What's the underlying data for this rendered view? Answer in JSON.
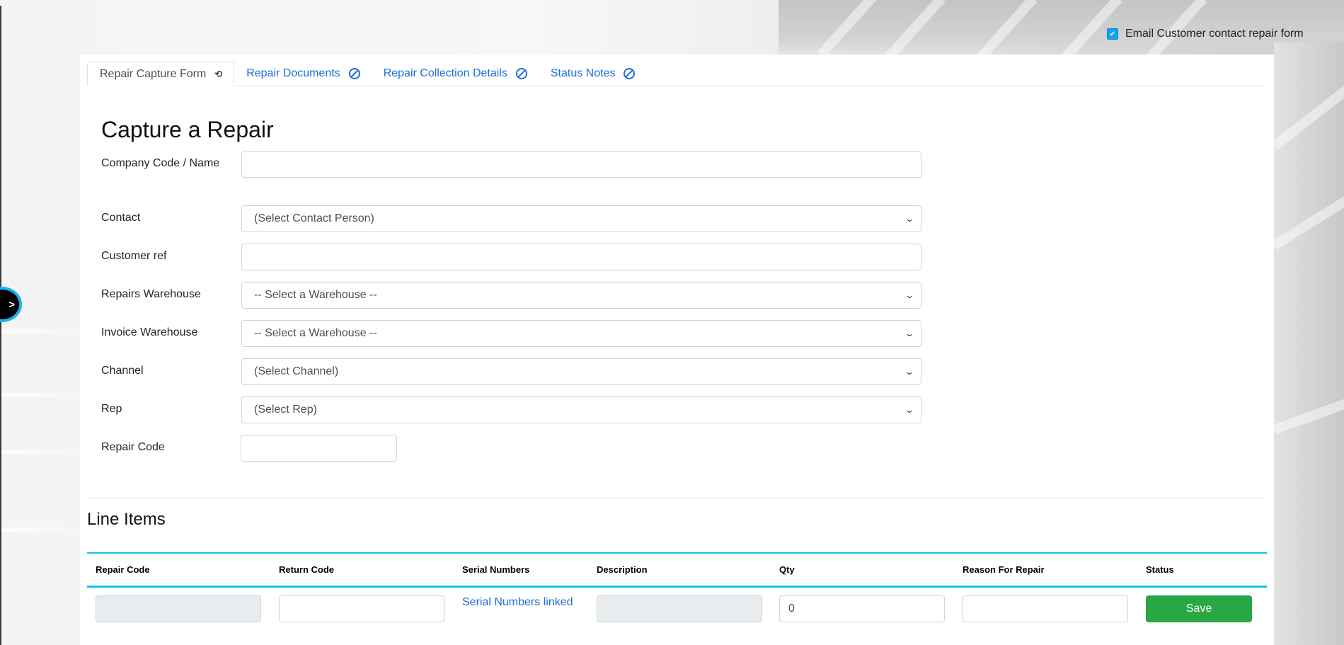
{
  "email_option": {
    "label": "Email Customer contact repair form",
    "checked": true,
    "check_glyph": "✔"
  },
  "sidebar_toggle": {
    "glyph": ">"
  },
  "tabs": [
    {
      "label": "Repair Capture Form",
      "active": true,
      "icon": "refresh-icon",
      "glyph": "⟲"
    },
    {
      "label": "Repair Documents",
      "active": false,
      "icon": "ban-icon"
    },
    {
      "label": "Repair Collection Details",
      "active": false,
      "icon": "ban-icon"
    },
    {
      "label": "Status Notes",
      "active": false,
      "icon": "ban-icon"
    }
  ],
  "form": {
    "title": "Capture a Repair",
    "fields": {
      "company": {
        "label": "Company Code / Name",
        "value": ""
      },
      "contact": {
        "label": "Contact",
        "selected": "(Select Contact Person)"
      },
      "customer_ref": {
        "label": "Customer ref",
        "value": ""
      },
      "repairs_warehouse": {
        "label": "Repairs Warehouse",
        "selected": "-- Select a Warehouse --"
      },
      "invoice_warehouse": {
        "label": "Invoice Warehouse",
        "selected": "-- Select a Warehouse --"
      },
      "channel": {
        "label": "Channel",
        "selected": "(Select Channel)"
      },
      "rep": {
        "label": "Rep",
        "selected": "(Select Rep)"
      },
      "repair_code": {
        "label": "Repair Code",
        "value": ""
      }
    },
    "chevron_glyph": "⌄"
  },
  "line_items": {
    "title": "Line Items",
    "columns": [
      "Repair Code",
      "Return Code",
      "Serial Numbers",
      "Description",
      "Qty",
      "Reason For Repair",
      "Status"
    ],
    "rows": [
      {
        "repair_code": "",
        "return_code": "",
        "serial_numbers_link": "Serial Numbers linked",
        "description": "",
        "qty": "0",
        "reason": "",
        "action_label": "Save"
      }
    ]
  },
  "colors": {
    "accent": "#17c1e8",
    "link": "#1a6fd6",
    "save_button": "#28a745",
    "checkbox": "#0ea5e9"
  }
}
